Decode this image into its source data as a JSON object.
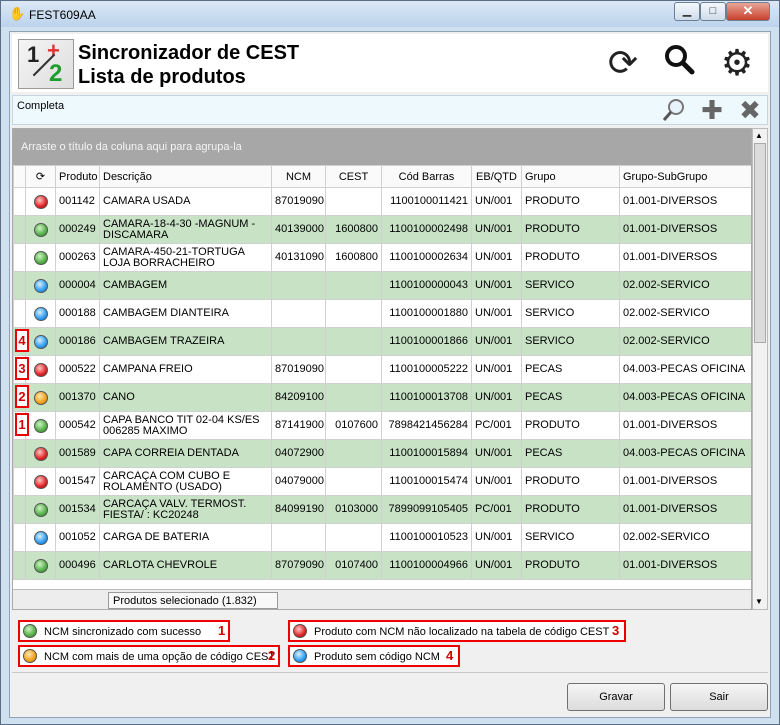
{
  "window": {
    "title": "FEST609AA",
    "min_label": "▁",
    "max_label": "□",
    "close_label": "✕"
  },
  "header": {
    "title": "Sincronizador de CEST",
    "subtitle": "Lista de produtos",
    "logo": {
      "n1": "1",
      "plus": "+",
      "n2": "2"
    }
  },
  "filter": {
    "label": "Completa"
  },
  "grid": {
    "group_hint": "Arraste o título da coluna aqui para agrupa-la",
    "columns": [
      "",
      "Produto",
      "Descrição",
      "NCM",
      "CEST",
      "Cód Barras",
      "EB/QTD",
      "Grupo",
      "Grupo-SubGrupo"
    ],
    "rows": [
      {
        "status": "red",
        "produto": "001142",
        "descricao": "CAMARA USADA",
        "ncm": "87019090",
        "cest": "",
        "barras": "1100100011421",
        "ebqtd": "UN/001",
        "grupo": "PRODUTO",
        "subgrupo": "01.001-DIVERSOS",
        "marker": ""
      },
      {
        "status": "green",
        "produto": "000249",
        "descricao": "CAMARA-18-4-30 -MAGNUM -DISCAMARA",
        "ncm": "40139000",
        "cest": "1600800",
        "barras": "1100100002498",
        "ebqtd": "UN/001",
        "grupo": "PRODUTO",
        "subgrupo": "01.001-DIVERSOS",
        "marker": ""
      },
      {
        "status": "green",
        "produto": "000263",
        "descricao": "CAMARA-450-21-TORTUGA LOJA BORRACHEIRO",
        "ncm": "40131090",
        "cest": "1600800",
        "barras": "1100100002634",
        "ebqtd": "UN/001",
        "grupo": "PRODUTO",
        "subgrupo": "01.001-DIVERSOS",
        "marker": ""
      },
      {
        "status": "blue",
        "produto": "000004",
        "descricao": "CAMBAGEM",
        "ncm": "",
        "cest": "",
        "barras": "1100100000043",
        "ebqtd": "UN/001",
        "grupo": "SERVICO",
        "subgrupo": "02.002-SERVICO",
        "marker": ""
      },
      {
        "status": "blue",
        "produto": "000188",
        "descricao": "CAMBAGEM DIANTEIRA",
        "ncm": "",
        "cest": "",
        "barras": "1100100001880",
        "ebqtd": "UN/001",
        "grupo": "SERVICO",
        "subgrupo": "02.002-SERVICO",
        "marker": ""
      },
      {
        "status": "blue",
        "produto": "000186",
        "descricao": "CAMBAGEM TRAZEIRA",
        "ncm": "",
        "cest": "",
        "barras": "1100100001866",
        "ebqtd": "UN/001",
        "grupo": "SERVICO",
        "subgrupo": "02.002-SERVICO",
        "marker": "4"
      },
      {
        "status": "red",
        "produto": "000522",
        "descricao": "CAMPANA FREIO",
        "ncm": "87019090",
        "cest": "",
        "barras": "1100100005222",
        "ebqtd": "UN/001",
        "grupo": "PECAS",
        "subgrupo": "04.003-PECAS OFICINA",
        "marker": "3"
      },
      {
        "status": "orange",
        "produto": "001370",
        "descricao": "CANO",
        "ncm": "84209100",
        "cest": "",
        "barras": "1100100013708",
        "ebqtd": "UN/001",
        "grupo": "PECAS",
        "subgrupo": "04.003-PECAS OFICINA",
        "marker": "2"
      },
      {
        "status": "green",
        "produto": "000542",
        "descricao": "CAPA BANCO TIT 02-04 KS/ES 006285 MAXIMO",
        "ncm": "87141900",
        "cest": "0107600",
        "barras": "7898421456284",
        "ebqtd": "PC/001",
        "grupo": "PRODUTO",
        "subgrupo": "01.001-DIVERSOS",
        "marker": "1"
      },
      {
        "status": "red",
        "produto": "001589",
        "descricao": "CAPA CORREIA DENTADA",
        "ncm": "04072900",
        "cest": "",
        "barras": "1100100015894",
        "ebqtd": "UN/001",
        "grupo": "PECAS",
        "subgrupo": "04.003-PECAS OFICINA",
        "marker": ""
      },
      {
        "status": "red",
        "produto": "001547",
        "descricao": "CARCAÇA COM CUBO E ROLAMENTO (USADO)",
        "ncm": "04079000",
        "cest": "",
        "barras": "1100100015474",
        "ebqtd": "UN/001",
        "grupo": "PRODUTO",
        "subgrupo": "01.001-DIVERSOS",
        "marker": ""
      },
      {
        "status": "green",
        "produto": "001534",
        "descricao": "CARCAÇA VALV. TERMOST. FIESTA/ : KC20248",
        "ncm": "84099190",
        "cest": "0103000",
        "barras": "7899099105405",
        "ebqtd": "PC/001",
        "grupo": "PRODUTO",
        "subgrupo": "01.001-DIVERSOS",
        "marker": ""
      },
      {
        "status": "blue",
        "produto": "001052",
        "descricao": "CARGA DE BATERIA",
        "ncm": "",
        "cest": "",
        "barras": "1100100010523",
        "ebqtd": "UN/001",
        "grupo": "SERVICO",
        "subgrupo": "02.002-SERVICO",
        "marker": ""
      },
      {
        "status": "green",
        "produto": "000496",
        "descricao": "CARLOTA  CHEVROLE",
        "ncm": "87079090",
        "cest": "0107400",
        "barras": "1100100004966",
        "ebqtd": "UN/001",
        "grupo": "PRODUTO",
        "subgrupo": "01.001-DIVERSOS",
        "marker": ""
      }
    ],
    "footer": "Produtos selecionado (1.832)"
  },
  "legend": [
    {
      "color": "green",
      "text": "NCM sincronizado com sucesso",
      "num": "1"
    },
    {
      "color": "red",
      "text": "Produto com NCM não localizado na tabela de código CEST",
      "num": "3"
    },
    {
      "color": "orange",
      "text": "NCM com mais de uma opção de código CEST",
      "num": "2"
    },
    {
      "color": "blue",
      "text": "Produto sem código NCM",
      "num": "4"
    }
  ],
  "buttons": {
    "save": "Gravar",
    "exit": "Sair"
  },
  "icons": {
    "sync": "sync-icon",
    "search": "search-icon",
    "settings": "gear-icon",
    "zoom": "magnifier-icon",
    "add": "plus-icon",
    "remove": "close-icon"
  }
}
